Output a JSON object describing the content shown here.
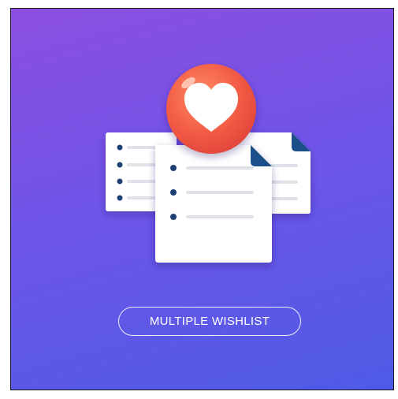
{
  "badge": {
    "label": "MULTIPLE WISHLIST"
  },
  "icons": {
    "heart": "heart-icon",
    "documents": "document-list-icon"
  },
  "colors": {
    "background_top": "#8c4fe0",
    "background_bottom": "#4e5be6",
    "heart_circle": "#f05a44",
    "page": "#ffffff",
    "page_fold": "#1e4f8a",
    "bullet": "#1e3f72",
    "line": "#dfe3e8"
  }
}
